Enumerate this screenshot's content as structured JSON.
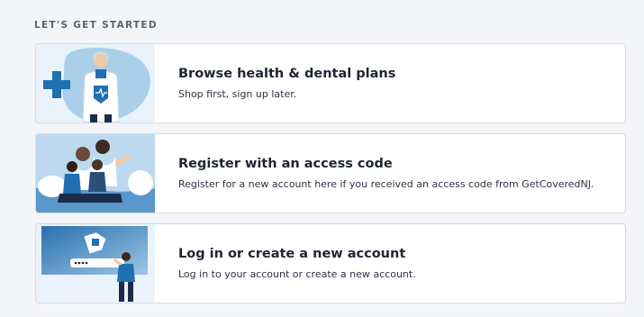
{
  "section": {
    "label": "LET'S GET STARTED"
  },
  "cards": [
    {
      "title": "Browse health & dental plans",
      "description": "Shop first, sign up later.",
      "illustration": "doctor-illustration"
    },
    {
      "title": "Register with an access code",
      "description": "Register for a new account here if you received an access code from GetCoveredNJ.",
      "illustration": "family-illustration"
    },
    {
      "title": "Log in or create a new account",
      "description": "Log in to your account or create a new account.",
      "illustration": "login-illustration"
    }
  ],
  "colors": {
    "background": "#f4f5f8",
    "card_background": "#ffffff",
    "card_border": "#d9dbe2",
    "title_text": "#1f2434",
    "accent_blue": "#1f6fb2",
    "illustration_background": "#e8f2fb"
  }
}
